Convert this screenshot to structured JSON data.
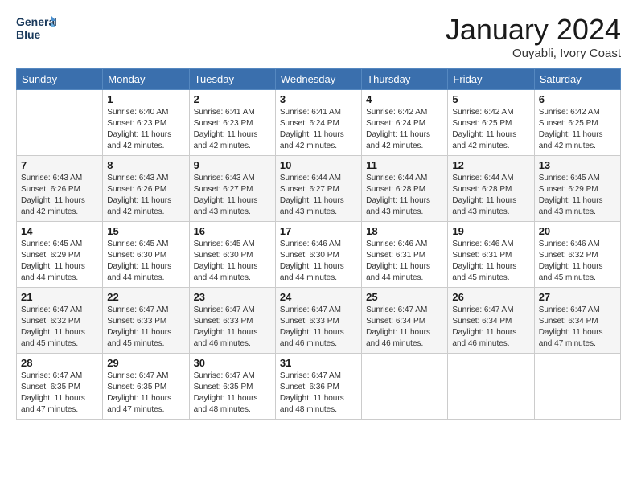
{
  "logo": {
    "line1": "General",
    "line2": "Blue"
  },
  "title": "January 2024",
  "location": "Ouyabli, Ivory Coast",
  "days_header": [
    "Sunday",
    "Monday",
    "Tuesday",
    "Wednesday",
    "Thursday",
    "Friday",
    "Saturday"
  ],
  "weeks": [
    [
      {
        "day": "",
        "sunrise": "",
        "sunset": "",
        "daylight": ""
      },
      {
        "day": "1",
        "sunrise": "Sunrise: 6:40 AM",
        "sunset": "Sunset: 6:23 PM",
        "daylight": "Daylight: 11 hours and 42 minutes."
      },
      {
        "day": "2",
        "sunrise": "Sunrise: 6:41 AM",
        "sunset": "Sunset: 6:23 PM",
        "daylight": "Daylight: 11 hours and 42 minutes."
      },
      {
        "day": "3",
        "sunrise": "Sunrise: 6:41 AM",
        "sunset": "Sunset: 6:24 PM",
        "daylight": "Daylight: 11 hours and 42 minutes."
      },
      {
        "day": "4",
        "sunrise": "Sunrise: 6:42 AM",
        "sunset": "Sunset: 6:24 PM",
        "daylight": "Daylight: 11 hours and 42 minutes."
      },
      {
        "day": "5",
        "sunrise": "Sunrise: 6:42 AM",
        "sunset": "Sunset: 6:25 PM",
        "daylight": "Daylight: 11 hours and 42 minutes."
      },
      {
        "day": "6",
        "sunrise": "Sunrise: 6:42 AM",
        "sunset": "Sunset: 6:25 PM",
        "daylight": "Daylight: 11 hours and 42 minutes."
      }
    ],
    [
      {
        "day": "7",
        "sunrise": "Sunrise: 6:43 AM",
        "sunset": "Sunset: 6:26 PM",
        "daylight": "Daylight: 11 hours and 42 minutes."
      },
      {
        "day": "8",
        "sunrise": "Sunrise: 6:43 AM",
        "sunset": "Sunset: 6:26 PM",
        "daylight": "Daylight: 11 hours and 42 minutes."
      },
      {
        "day": "9",
        "sunrise": "Sunrise: 6:43 AM",
        "sunset": "Sunset: 6:27 PM",
        "daylight": "Daylight: 11 hours and 43 minutes."
      },
      {
        "day": "10",
        "sunrise": "Sunrise: 6:44 AM",
        "sunset": "Sunset: 6:27 PM",
        "daylight": "Daylight: 11 hours and 43 minutes."
      },
      {
        "day": "11",
        "sunrise": "Sunrise: 6:44 AM",
        "sunset": "Sunset: 6:28 PM",
        "daylight": "Daylight: 11 hours and 43 minutes."
      },
      {
        "day": "12",
        "sunrise": "Sunrise: 6:44 AM",
        "sunset": "Sunset: 6:28 PM",
        "daylight": "Daylight: 11 hours and 43 minutes."
      },
      {
        "day": "13",
        "sunrise": "Sunrise: 6:45 AM",
        "sunset": "Sunset: 6:29 PM",
        "daylight": "Daylight: 11 hours and 43 minutes."
      }
    ],
    [
      {
        "day": "14",
        "sunrise": "Sunrise: 6:45 AM",
        "sunset": "Sunset: 6:29 PM",
        "daylight": "Daylight: 11 hours and 44 minutes."
      },
      {
        "day": "15",
        "sunrise": "Sunrise: 6:45 AM",
        "sunset": "Sunset: 6:30 PM",
        "daylight": "Daylight: 11 hours and 44 minutes."
      },
      {
        "day": "16",
        "sunrise": "Sunrise: 6:45 AM",
        "sunset": "Sunset: 6:30 PM",
        "daylight": "Daylight: 11 hours and 44 minutes."
      },
      {
        "day": "17",
        "sunrise": "Sunrise: 6:46 AM",
        "sunset": "Sunset: 6:30 PM",
        "daylight": "Daylight: 11 hours and 44 minutes."
      },
      {
        "day": "18",
        "sunrise": "Sunrise: 6:46 AM",
        "sunset": "Sunset: 6:31 PM",
        "daylight": "Daylight: 11 hours and 44 minutes."
      },
      {
        "day": "19",
        "sunrise": "Sunrise: 6:46 AM",
        "sunset": "Sunset: 6:31 PM",
        "daylight": "Daylight: 11 hours and 45 minutes."
      },
      {
        "day": "20",
        "sunrise": "Sunrise: 6:46 AM",
        "sunset": "Sunset: 6:32 PM",
        "daylight": "Daylight: 11 hours and 45 minutes."
      }
    ],
    [
      {
        "day": "21",
        "sunrise": "Sunrise: 6:47 AM",
        "sunset": "Sunset: 6:32 PM",
        "daylight": "Daylight: 11 hours and 45 minutes."
      },
      {
        "day": "22",
        "sunrise": "Sunrise: 6:47 AM",
        "sunset": "Sunset: 6:33 PM",
        "daylight": "Daylight: 11 hours and 45 minutes."
      },
      {
        "day": "23",
        "sunrise": "Sunrise: 6:47 AM",
        "sunset": "Sunset: 6:33 PM",
        "daylight": "Daylight: 11 hours and 46 minutes."
      },
      {
        "day": "24",
        "sunrise": "Sunrise: 6:47 AM",
        "sunset": "Sunset: 6:33 PM",
        "daylight": "Daylight: 11 hours and 46 minutes."
      },
      {
        "day": "25",
        "sunrise": "Sunrise: 6:47 AM",
        "sunset": "Sunset: 6:34 PM",
        "daylight": "Daylight: 11 hours and 46 minutes."
      },
      {
        "day": "26",
        "sunrise": "Sunrise: 6:47 AM",
        "sunset": "Sunset: 6:34 PM",
        "daylight": "Daylight: 11 hours and 46 minutes."
      },
      {
        "day": "27",
        "sunrise": "Sunrise: 6:47 AM",
        "sunset": "Sunset: 6:34 PM",
        "daylight": "Daylight: 11 hours and 47 minutes."
      }
    ],
    [
      {
        "day": "28",
        "sunrise": "Sunrise: 6:47 AM",
        "sunset": "Sunset: 6:35 PM",
        "daylight": "Daylight: 11 hours and 47 minutes."
      },
      {
        "day": "29",
        "sunrise": "Sunrise: 6:47 AM",
        "sunset": "Sunset: 6:35 PM",
        "daylight": "Daylight: 11 hours and 47 minutes."
      },
      {
        "day": "30",
        "sunrise": "Sunrise: 6:47 AM",
        "sunset": "Sunset: 6:35 PM",
        "daylight": "Daylight: 11 hours and 48 minutes."
      },
      {
        "day": "31",
        "sunrise": "Sunrise: 6:47 AM",
        "sunset": "Sunset: 6:36 PM",
        "daylight": "Daylight: 11 hours and 48 minutes."
      },
      {
        "day": "",
        "sunrise": "",
        "sunset": "",
        "daylight": ""
      },
      {
        "day": "",
        "sunrise": "",
        "sunset": "",
        "daylight": ""
      },
      {
        "day": "",
        "sunrise": "",
        "sunset": "",
        "daylight": ""
      }
    ]
  ]
}
